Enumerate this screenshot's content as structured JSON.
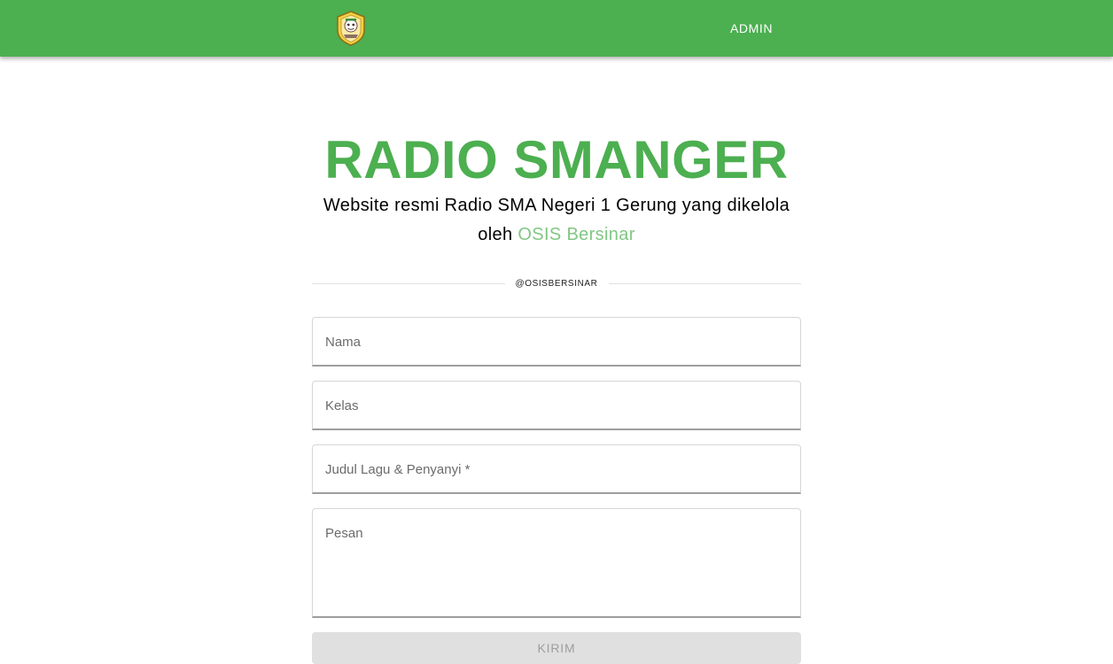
{
  "header": {
    "logo_icon": "school-crest-icon",
    "admin_label": "ADMIN",
    "bar_color": "#4caf50"
  },
  "hero": {
    "title": "RADIO SMANGER",
    "subtitle_text": "Website resmi Radio SMA Negeri 1 Gerung yang dikelola oleh ",
    "subtitle_link": "OSIS Bersinar",
    "accent_color": "#4caf50",
    "link_color": "#81c784"
  },
  "divider": {
    "handle": "@OSISBERSINAR"
  },
  "form": {
    "nama_label": "Nama",
    "kelas_label": "Kelas",
    "judul_label": "Judul Lagu & Penyanyi *",
    "pesan_label": "Pesan",
    "submit_label": "KIRIM"
  }
}
